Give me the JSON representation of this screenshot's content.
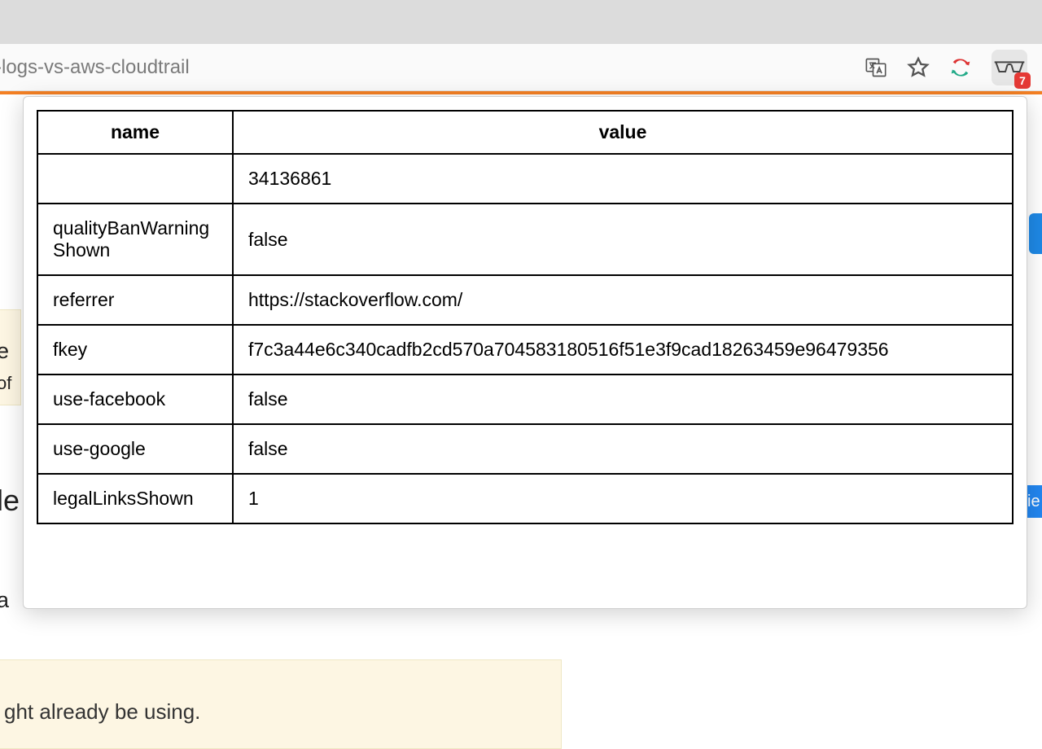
{
  "address_bar": {
    "url_fragment": "-logs-vs-aws-cloudtrail",
    "badge_count": "7"
  },
  "background": {
    "line2": "ght already be using.",
    "e": "e",
    "of": "of",
    "le": "le",
    "a": "a",
    "ie": "ie"
  },
  "table": {
    "headers": {
      "name": "name",
      "value": "value"
    },
    "rows": [
      {
        "name": "",
        "value": "34136861"
      },
      {
        "name": "qualityBanWarningShown",
        "value": "false"
      },
      {
        "name": "referrer",
        "value": "https://stackoverflow.com/"
      },
      {
        "name": "fkey",
        "value": "f7c3a44e6c340cadfb2cd570a704583180516f51e3f9cad18263459e96479356"
      },
      {
        "name": "use-facebook",
        "value": "false"
      },
      {
        "name": "use-google",
        "value": "false"
      },
      {
        "name": "legalLinksShown",
        "value": "1"
      }
    ]
  }
}
